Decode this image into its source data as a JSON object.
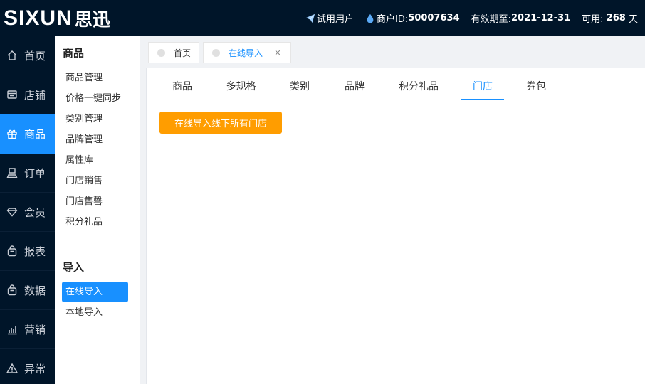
{
  "brand": {
    "latin": "SIXUN",
    "cn": "思迅"
  },
  "header": {
    "trial_label": "试用用户",
    "merchant_label": "商户ID:",
    "merchant_id": "50007634",
    "expiry_label": "有效期至:",
    "expiry_date": "2021-12-31",
    "avail_label": "可用:",
    "avail_days": "268",
    "days_unit": "天"
  },
  "nav": [
    {
      "label": "首页",
      "icon": "home-icon"
    },
    {
      "label": "店铺",
      "icon": "store-icon"
    },
    {
      "label": "商品",
      "icon": "gift-icon",
      "active": true
    },
    {
      "label": "订单",
      "icon": "printer-icon"
    },
    {
      "label": "会员",
      "icon": "diamond-icon"
    },
    {
      "label": "报表",
      "icon": "bag-icon"
    },
    {
      "label": "数据",
      "icon": "bag-icon"
    },
    {
      "label": "营销",
      "icon": "bar-chart-icon"
    },
    {
      "label": "异常",
      "icon": "warning-icon"
    }
  ],
  "submenu": {
    "section1": "商品",
    "items1": [
      "商品管理",
      "价格一键同步",
      "类别管理",
      "品牌管理",
      "属性库",
      "门店销售",
      "门店售罄",
      "积分礼品"
    ],
    "section2": "导入",
    "items2": [
      "在线导入",
      "本地导入"
    ]
  },
  "page_tabs": [
    {
      "label": "首页"
    },
    {
      "label": "在线导入",
      "active": true,
      "close": "×"
    }
  ],
  "content_tabs": [
    "商品",
    "多规格",
    "类别",
    "品牌",
    "积分礼品",
    "门店",
    "券包"
  ],
  "active_content_tab": "门店",
  "import_button": "在线导入线下所有门店",
  "colors": {
    "header_bg": "#001529",
    "accent": "#1890ff",
    "button": "#ff9d00"
  }
}
